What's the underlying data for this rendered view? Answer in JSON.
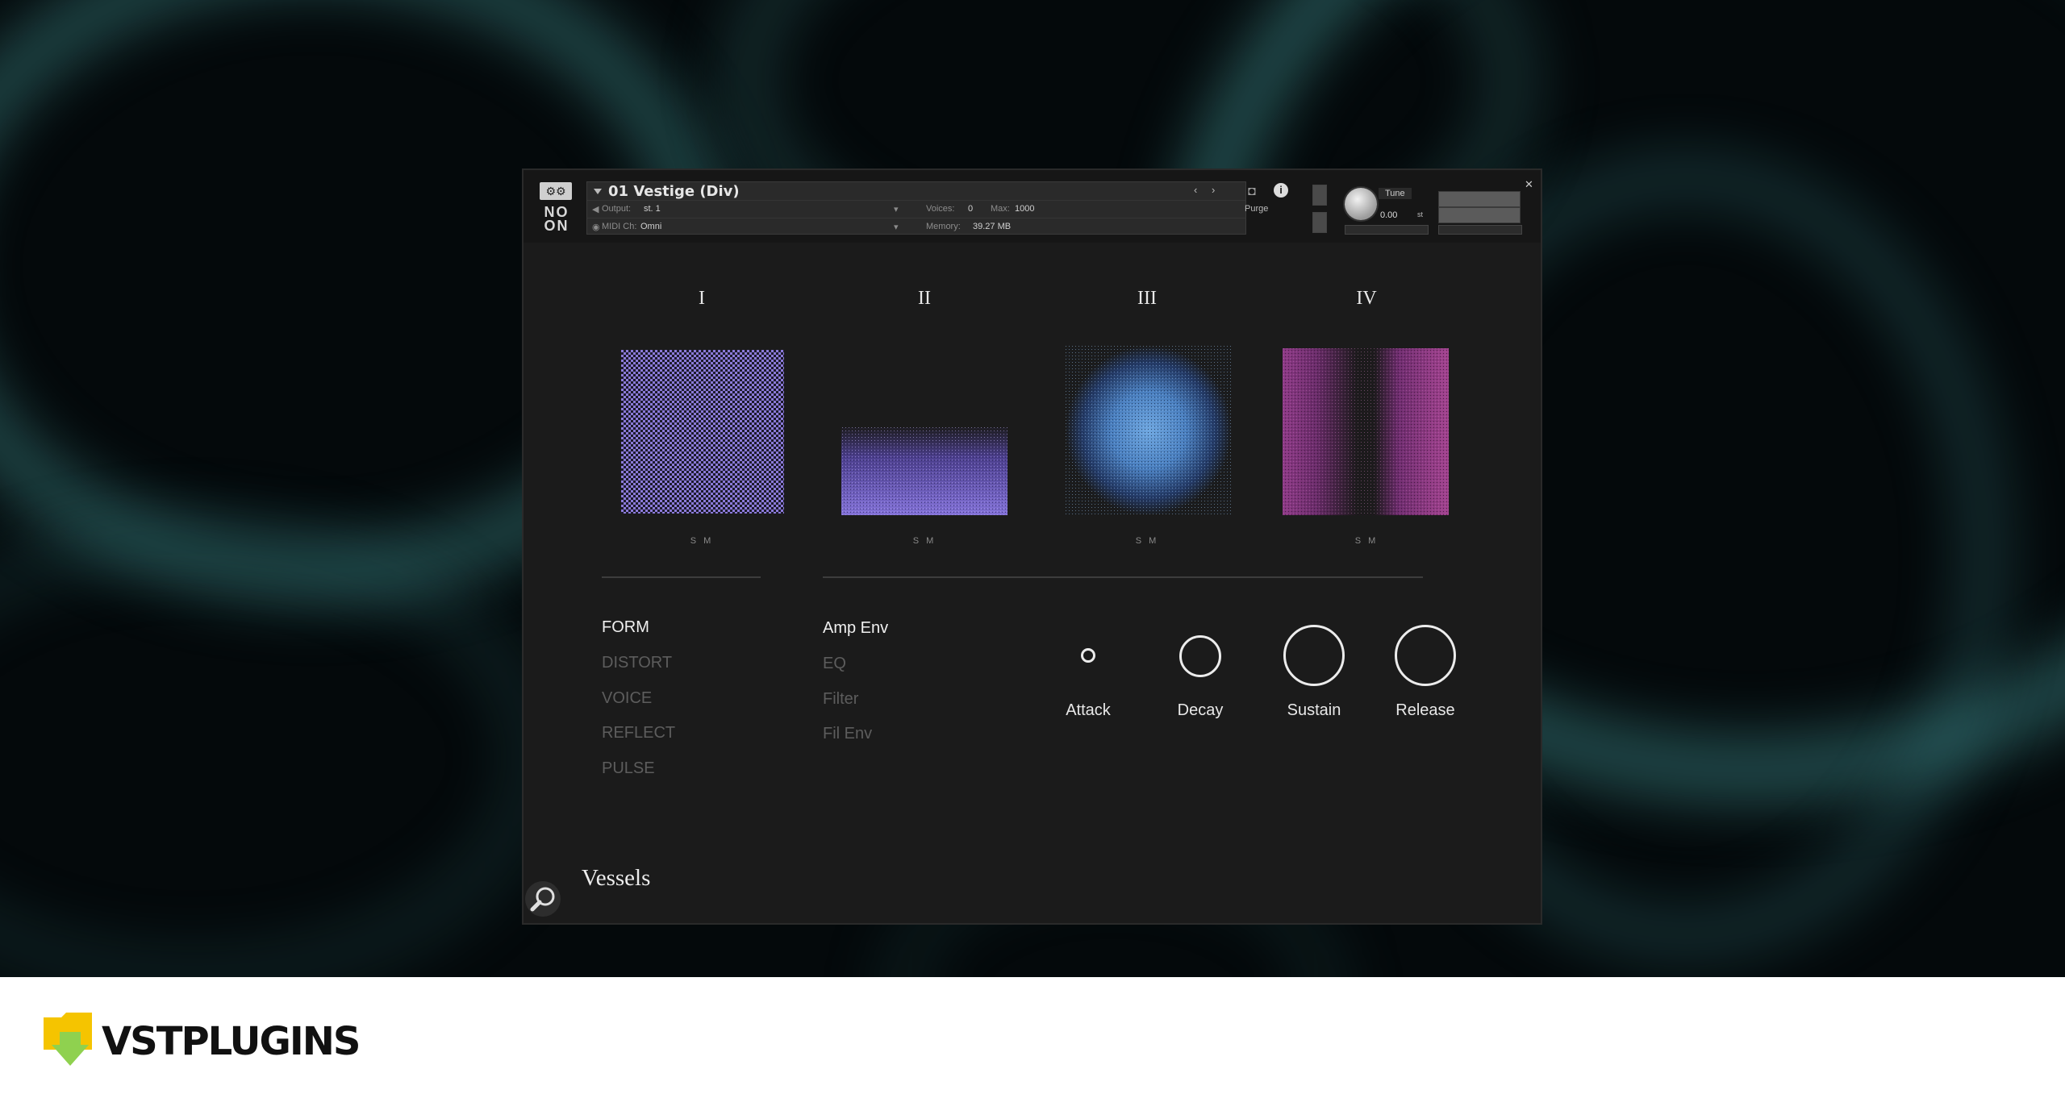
{
  "header": {
    "instrument_name": "01 Vestige (Div)",
    "output_label": "Output:",
    "output_value": "st. 1",
    "voices_label": "Voices:",
    "voices_value": "0",
    "max_label": "Max:",
    "max_value": "1000",
    "midi_label": "MIDI Ch:",
    "midi_value": "Omni",
    "memory_label": "Memory:",
    "memory_value": "39.27 MB",
    "purge_label": "Purge",
    "tune_label": "Tune",
    "tune_value": "0.00",
    "tune_unit": "st",
    "brand_mark_top": "NO",
    "brand_mark_bottom": "ON"
  },
  "layers": [
    {
      "numeral": "I",
      "solo": "S",
      "mute": "M",
      "color": "#8a78d6"
    },
    {
      "numeral": "II",
      "solo": "S",
      "mute": "M",
      "color": "#7b6ad2"
    },
    {
      "numeral": "III",
      "solo": "S",
      "mute": "M",
      "color": "#4f86c0"
    },
    {
      "numeral": "IV",
      "solo": "S",
      "mute": "M",
      "color": "#a2438f"
    }
  ],
  "menu_left": {
    "active": "FORM",
    "items": [
      "FORM",
      "DISTORT",
      "VOICE",
      "REFLECT",
      "PULSE"
    ]
  },
  "menu_right": {
    "active": "Amp Env",
    "items": [
      "Amp Env",
      "EQ",
      "Filter",
      "Fil Env"
    ]
  },
  "envelope": {
    "knobs": [
      {
        "label": "Attack"
      },
      {
        "label": "Decay"
      },
      {
        "label": "Sustain"
      },
      {
        "label": "Release"
      }
    ]
  },
  "product": {
    "name": "Vessels"
  },
  "banner": {
    "brand": "VSTPLUGINS",
    "logo_color": "#f5c400",
    "logo_accent": "#8fd14f"
  }
}
